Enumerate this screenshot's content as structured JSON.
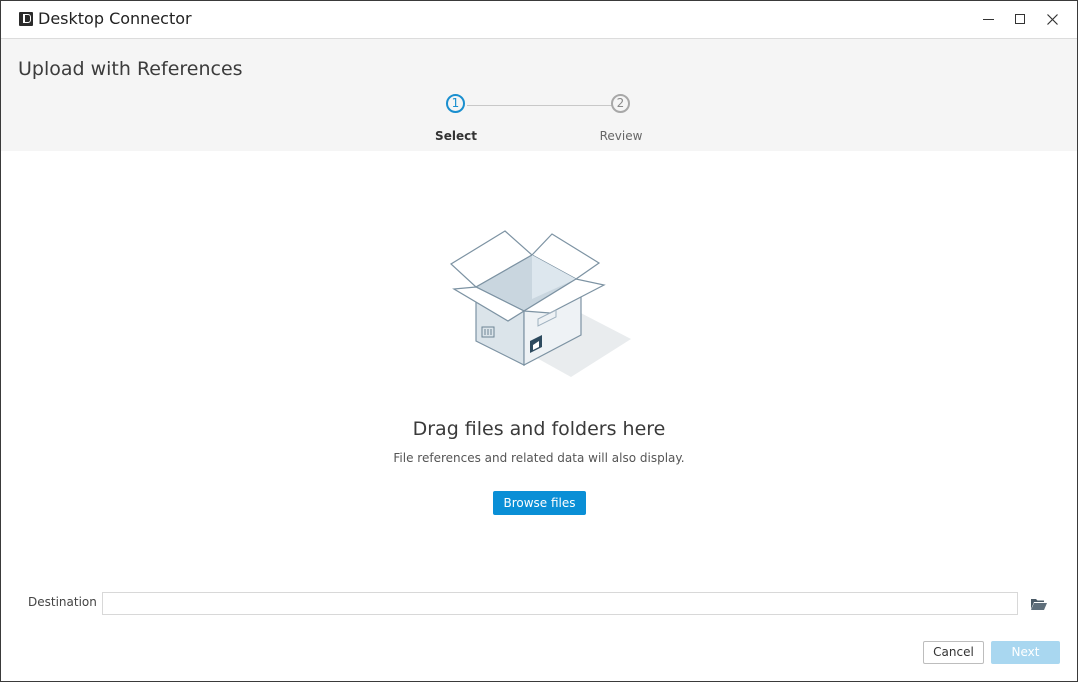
{
  "window": {
    "title": "Desktop Connector",
    "icon": "desktop-connector-app-icon",
    "controls": [
      "minimize-icon",
      "maximize-icon",
      "close-icon"
    ]
  },
  "header": {
    "title": "Upload with References",
    "steps": [
      {
        "number": "1",
        "label": "Select",
        "state": "active"
      },
      {
        "number": "2",
        "label": "Review",
        "state": "inactive"
      }
    ]
  },
  "dropzone": {
    "illustration": "open-box-icon",
    "heading": "Drag files and folders here",
    "subtext": "File references and related data will also display.",
    "browse_label": "Browse files"
  },
  "destination": {
    "label": "Destination",
    "value": "",
    "folder_icon": "folder-open-icon"
  },
  "footer": {
    "cancel_label": "Cancel",
    "next_label": "Next",
    "next_enabled": false
  },
  "colors": {
    "accent": "#0a8fd6",
    "step_active": "#1a8fcf",
    "next_disabled": "#a9d7f0",
    "header_bg": "#f5f5f5"
  }
}
